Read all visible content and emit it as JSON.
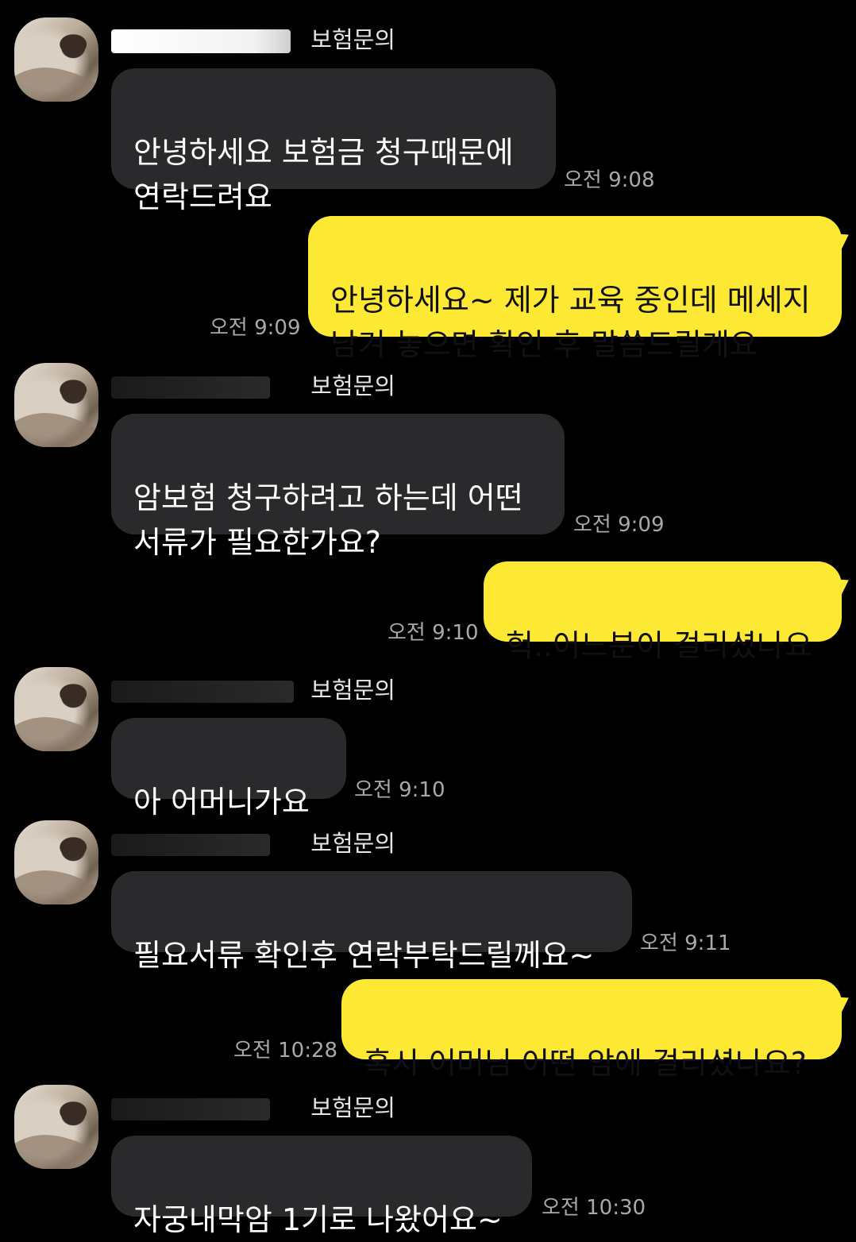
{
  "conversation": {
    "sender_suffix": "보험문의",
    "messages": [
      {
        "side": "in",
        "text": "안녕하세요 보험금 청구때문에\n연락드려요",
        "time": "오전 9:08"
      },
      {
        "side": "out",
        "text": "안녕하세요~ 제가 교육 중인데 메세지\n남겨 놓으면 확인 후 말씀드릴게요",
        "time": "오전 9:09"
      },
      {
        "side": "in",
        "text": "암보험 청구하려고 하는데 어떤\n서류가 필요한가요?",
        "time": "오전 9:09"
      },
      {
        "side": "out",
        "text": "헉..어느분이 걸리셨나요",
        "time": "오전 9:10"
      },
      {
        "side": "in",
        "text": "아 어머니가요",
        "time": "오전 9:10"
      },
      {
        "side": "in",
        "text": "필요서류 확인후 연락부탁드릴께요~",
        "time": "오전 9:11"
      },
      {
        "side": "out",
        "text": "혹시 어머님 어떤 암에 걸리셨나요?",
        "time": "오전 10:28"
      },
      {
        "side": "in",
        "text": "자궁내막암 1기로 나왔어요~",
        "time": "오전 10:30"
      }
    ]
  },
  "colors": {
    "background": "#000000",
    "incoming_bubble": "#2a2a2c",
    "outgoing_bubble": "#fde933",
    "timestamp": "#a9a9a9"
  },
  "icons": {
    "avatar": "profile-photo"
  }
}
